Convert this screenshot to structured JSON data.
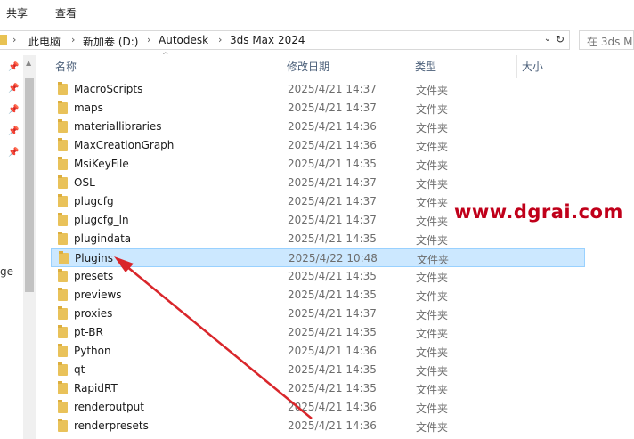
{
  "ribbon": {
    "tabs": [
      "共享",
      "查看"
    ]
  },
  "address": {
    "crumbs": [
      "此电脑",
      "新加卷 (D:)",
      "Autodesk",
      "3ds Max 2024"
    ],
    "search_placeholder": "在 3ds M"
  },
  "nav_fragment": "ge",
  "columns": {
    "name": "名称",
    "date": "修改日期",
    "type": "类型",
    "size": "大小"
  },
  "rows": [
    {
      "name": "MacroScripts",
      "date": "2025/4/21 14:37",
      "type": "文件夹"
    },
    {
      "name": "maps",
      "date": "2025/4/21 14:37",
      "type": "文件夹"
    },
    {
      "name": "materiallibraries",
      "date": "2025/4/21 14:36",
      "type": "文件夹"
    },
    {
      "name": "MaxCreationGraph",
      "date": "2025/4/21 14:36",
      "type": "文件夹"
    },
    {
      "name": "MsiKeyFile",
      "date": "2025/4/21 14:35",
      "type": "文件夹"
    },
    {
      "name": "OSL",
      "date": "2025/4/21 14:37",
      "type": "文件夹"
    },
    {
      "name": "plugcfg",
      "date": "2025/4/21 14:37",
      "type": "文件夹"
    },
    {
      "name": "plugcfg_ln",
      "date": "2025/4/21 14:37",
      "type": "文件夹"
    },
    {
      "name": "plugindata",
      "date": "2025/4/21 14:35",
      "type": "文件夹"
    },
    {
      "name": "Plugins",
      "date": "2025/4/22 10:48",
      "type": "文件夹",
      "selected": true
    },
    {
      "name": "presets",
      "date": "2025/4/21 14:35",
      "type": "文件夹"
    },
    {
      "name": "previews",
      "date": "2025/4/21 14:35",
      "type": "文件夹"
    },
    {
      "name": "proxies",
      "date": "2025/4/21 14:37",
      "type": "文件夹"
    },
    {
      "name": "pt-BR",
      "date": "2025/4/21 14:35",
      "type": "文件夹"
    },
    {
      "name": "Python",
      "date": "2025/4/21 14:36",
      "type": "文件夹"
    },
    {
      "name": "qt",
      "date": "2025/4/21 14:35",
      "type": "文件夹"
    },
    {
      "name": "RapidRT",
      "date": "2025/4/21 14:35",
      "type": "文件夹"
    },
    {
      "name": "renderoutput",
      "date": "2025/4/21 14:36",
      "type": "文件夹"
    },
    {
      "name": "renderpresets",
      "date": "2025/4/21 14:36",
      "type": "文件夹"
    }
  ],
  "watermark": "www.dgrai.com",
  "colors": {
    "selection": "#cce8ff",
    "folder": "#e9c25a",
    "arrow": "#d9262b",
    "watermark": "#c0001a"
  }
}
